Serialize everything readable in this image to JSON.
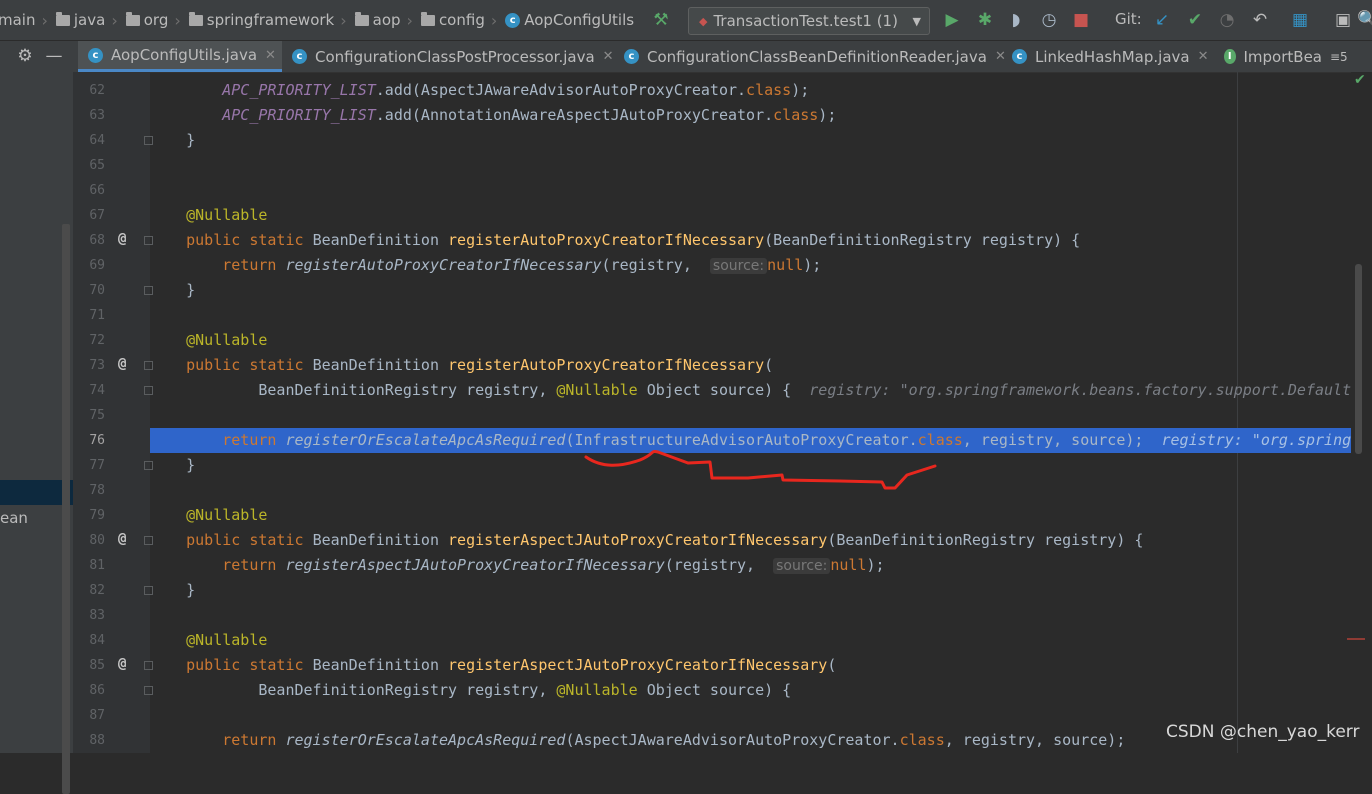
{
  "breadcrumbs": [
    "main",
    "java",
    "org",
    "springframework",
    "aop",
    "config"
  ],
  "breadcrumb_file": "AopConfigUtils",
  "run_config": "TransactionTest.test1 (1)",
  "git_label": "Git:",
  "tabs": [
    {
      "label": "AopConfigUtils.java",
      "active": true
    },
    {
      "label": "ConfigurationClassPostProcessor.java",
      "active": false
    },
    {
      "label": "ConfigurationClassBeanDefinitionReader.java",
      "active": false
    },
    {
      "label": "LinkedHashMap.java",
      "active": false
    },
    {
      "label": "ImportBea",
      "active": false
    }
  ],
  "tab_overflow": "≡5",
  "left_panel_item": "ean",
  "line_numbers": [
    "62",
    "63",
    "64",
    "65",
    "66",
    "67",
    "68",
    "69",
    "70",
    "71",
    "72",
    "73",
    "74",
    "75",
    "76",
    "77",
    "78",
    "79",
    "80",
    "81",
    "82",
    "83",
    "84",
    "85",
    "86",
    "87",
    "88"
  ],
  "current_line": "76",
  "code": {
    "l62_a": "APC_PRIORITY_LIST",
    "l62_b": ".add(AspectJAwareAdvisorAutoProxyCreator.",
    "l63_a": "APC_PRIORITY_LIST",
    "l63_b": ".add(AnnotationAwareAspectJAutoProxyCreator.",
    "class_kw": "class",
    "l64": "}",
    "nullable": "@Nullable",
    "public_static": "public static",
    "bean_def": "BeanDefinition",
    "fn_register_auto": "registerAutoProxyCreatorIfNecessary",
    "l68_param": "(BeanDefinitionRegistry registry) {",
    "return_kw": "return",
    "l69_call": "registerAutoProxyCreatorIfNecessary",
    "l69_arg": "(registry,",
    "hint_source": "source:",
    "null_kw": "null",
    "close_paren": ");",
    "l73_open": "(",
    "l74_a": "BeanDefinitionRegistry registry,",
    "l74_b": "Object source) {",
    "l74_debug": "registry: \"org.springframework.beans.factory.support.DefaultL",
    "l76_call": "registerOrEscalateApcAsRequired",
    "l76_args": "(InfrastructureAdvisorAutoProxyCreator.",
    "l76_rest": ", registry, source);",
    "l76_debug": "registry: \"org.springf",
    "fn_register_aspectj": "registerAspectJAutoProxyCreatorIfNecessary",
    "l88_args": "(AspectJAwareAdvisorAutoProxyCreator.",
    "l88_rest": ", registry, source);"
  },
  "watermark": "CSDN @chen_yao_kerr",
  "colors": {
    "editor_bg": "#2b2b2b",
    "highlight": "#2f65ca",
    "keyword": "#cc7832",
    "method": "#ffc66d",
    "annotation": "#bbb529",
    "static_field": "#9876aa",
    "underline_mark": "#e8271e"
  }
}
